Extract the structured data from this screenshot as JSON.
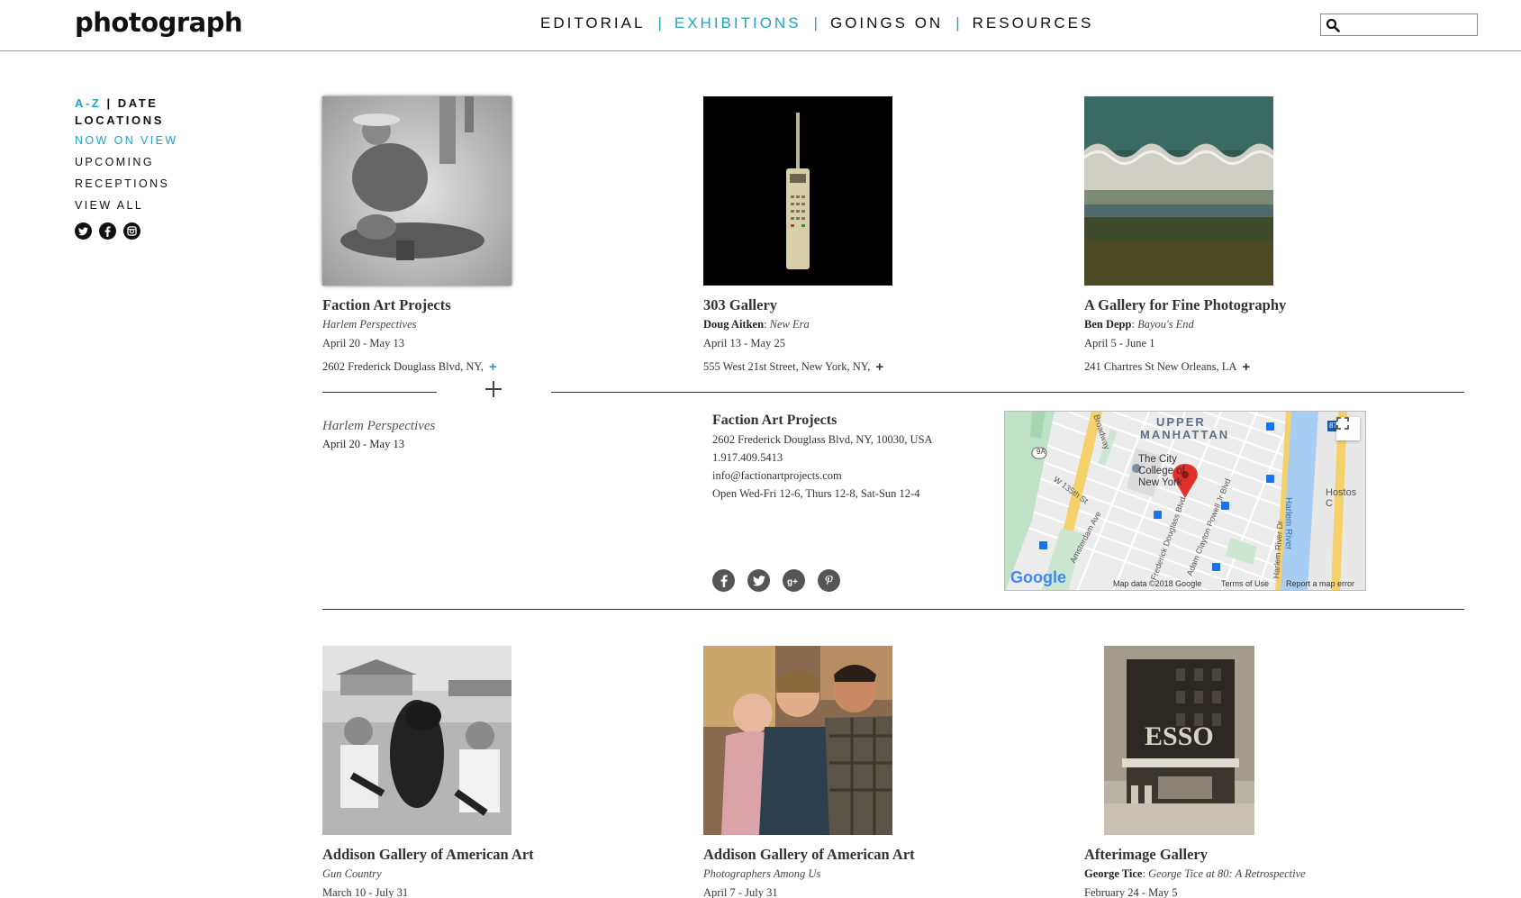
{
  "site": {
    "logo": "photograph"
  },
  "nav": {
    "items": [
      {
        "label": "EDITORIAL",
        "active": false
      },
      {
        "label": "EXHIBITIONS",
        "active": true
      },
      {
        "label": "GOINGS ON",
        "active": false
      },
      {
        "label": "RESOURCES",
        "active": false
      }
    ],
    "separator": "|"
  },
  "search": {
    "placeholder": "",
    "icon": "search-icon"
  },
  "sidebar": {
    "sort_az": "A-Z",
    "sort_sep": "|",
    "sort_date": "DATE",
    "locations": "LOCATIONS",
    "filters": [
      "NOW ON VIEW",
      "UPCOMING",
      "RECEPTIONS",
      "VIEW ALL"
    ],
    "social_icons": [
      "twitter-icon",
      "facebook-icon",
      "instagram-icon"
    ]
  },
  "cards": [
    {
      "gallery": "Faction Art Projects",
      "artist": "",
      "show": "Harlem Perspectives",
      "dates": "April 20 - May 13",
      "address": "2602 Frederick Douglass Blvd, NY,",
      "plus": "+"
    },
    {
      "gallery": "303 Gallery",
      "artist": "Doug Aitken",
      "show": "New Era",
      "dates": "April 13 - May 25",
      "address": "555 West 21st Street, New York, NY,",
      "plus": "+"
    },
    {
      "gallery": "A Gallery for Fine Photography",
      "artist": "Ben Depp",
      "show": "Bayou's End",
      "dates": "April 5 - June 1",
      "address": "241 Chartres St New Orleans, LA",
      "plus": "+"
    },
    {
      "gallery": "Addison Gallery of American Art",
      "artist": "",
      "show": "Gun Country",
      "dates": "March 10 - July 31"
    },
    {
      "gallery": "Addison Gallery of American Art",
      "artist": "",
      "show": "Photographers Among Us",
      "dates": "April 7 - July 31"
    },
    {
      "gallery": "Afterimage Gallery",
      "artist": "George Tice",
      "show": "George Tice at 80: A Retrospective",
      "dates": "February 24 - May 5"
    }
  ],
  "detail": {
    "show": "Harlem Perspectives",
    "dates": "April 20 - May 13",
    "name": "Faction Art Projects",
    "address": "2602 Frederick Douglass Blvd, NY, 10030, USA",
    "phone": "1.917.409.5413",
    "email": "info@factionartprojects.com",
    "hours": "Open Wed-Fri 12-6, Thurs 12-8, Sat-Sun 12-4",
    "share_icons": [
      "facebook-icon",
      "twitter-icon",
      "google-plus-icon",
      "pinterest-icon"
    ]
  },
  "map": {
    "area_label_1": "UPPER",
    "area_label_2": "MANHATTAN",
    "place_label": "The City College of New York",
    "streets": [
      "Broadway",
      "W 135th St",
      "Amsterdam Ave",
      "Frederick Douglass Blvd",
      "Adam Clayton Powell Jr Blvd",
      "Harlem River Dr",
      "Harlem River",
      "Hostos C"
    ],
    "shield_9a": "9A",
    "shield_87": "87",
    "logo": "Google",
    "footer": [
      "Map data ©2018 Google",
      "Terms of Use",
      "Report a map error"
    ]
  }
}
